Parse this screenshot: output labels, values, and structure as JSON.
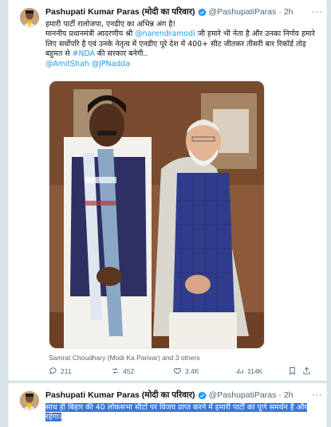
{
  "tweet1": {
    "author_name": "Pashupati Kumar Paras (मोदी का परिवार)",
    "handle": "@PashupatiParas",
    "dot": "·",
    "time": "2h",
    "more": "···",
    "line1": "हमारी पार्टी रालोजपा, एनडीए का अभिन्न अंग है!",
    "line2_a": "माननीय प्रधानमंत्री आदरणीय श्री ",
    "line2_mention": "@narendramodi",
    "line2_b": " जी हमारे भी नेता है और उनका निर्णय हमारे लिए सर्वोपरि है एवं उनके नेतृत्व में एनडीए पूरे देश में 400+ सीट जीतकर तीसरी बार रिकॉर्ड तोड़ बहुमत से ",
    "line2_hashtag": "#NDA",
    "line2_c": " की सरकार बनेगी..",
    "mention_amit": "@AmitShah",
    "mention_jp": "@JPNadda",
    "tagged": "Samrat Choudhary (Modi Ka Parivar) and 3 others",
    "replies": "211",
    "reposts": "452",
    "likes": "3.4K",
    "views": "114K"
  },
  "tweet2": {
    "author_name": "Pashupati Kumar Paras (मोदी का परिवार)",
    "handle": "@PashupatiParas",
    "dot": "·",
    "time": "2h",
    "more": "···",
    "text": "साथ ही बिहार की 40 लोकसभा सीटों पर विजय प्राप्त करने में हमारी पार्टी का पूर्ण समर्थन है और रहेगा।"
  },
  "colors": {
    "accent": "#1d9bf0",
    "highlight": "#3a76d6",
    "muted": "#536471"
  }
}
